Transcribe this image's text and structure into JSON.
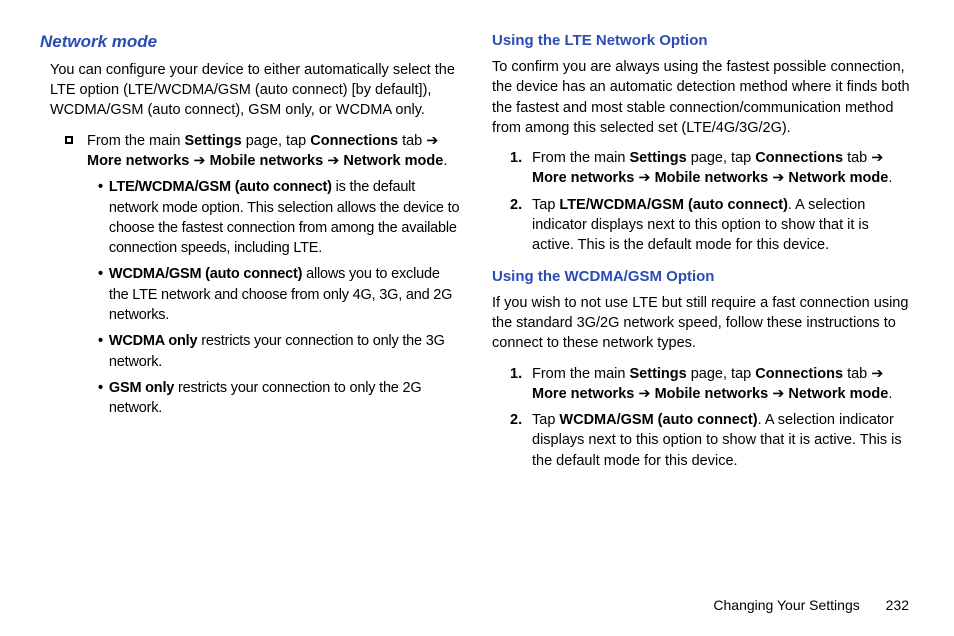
{
  "col1": {
    "heading": "Network mode",
    "intro": "You can configure your device to either automatically select the LTE option (LTE/WCDMA/GSM (auto connect) [by default]), WCDMA/GSM (auto connect), GSM only, or WCDMA only.",
    "main_step": {
      "t1": "From the main ",
      "b1": "Settings",
      "t2": " page, tap ",
      "b2": "Connections",
      "t3": " tab ",
      "arr1": "➔",
      "t4": " ",
      "b3": "More networks",
      "t5": " ",
      "arr2": "➔",
      "t6": " ",
      "b4": "Mobile networks",
      "t7": " ",
      "arr3": "➔",
      "t8": " ",
      "b5": "Network mode",
      "t9": "."
    },
    "opt1": {
      "b": "LTE/WCDMA/GSM (auto connect)",
      "t": " is the default network mode option. This selection allows the device to choose the fastest connection from among the available connection speeds, including LTE."
    },
    "opt2": {
      "b": "WCDMA/GSM (auto connect)",
      "t": " allows you to exclude the LTE network and choose from only 4G, 3G, and 2G networks."
    },
    "opt3": {
      "b": "WCDMA only",
      "t": " restricts your connection to only the 3G network."
    },
    "opt4": {
      "b": "GSM only",
      "t": " restricts your connection to only the 2G network."
    }
  },
  "col2": {
    "h1": "Using the LTE Network Option",
    "p1": "To confirm you are always using the fastest possible connection, the device has an automatic detection method where it finds both the fastest and most stable connection/communication method from among this selected set (LTE/4G/3G/2G).",
    "lte_step1": {
      "num": "1.",
      "t1": "From the main ",
      "b1": "Settings",
      "t2": " page, tap ",
      "b2": "Connections",
      "t3": " tab ",
      "arr1": "➔",
      "t4": " ",
      "b3": "More networks",
      "t5": " ",
      "arr2": "➔",
      "t6": " ",
      "b4": "Mobile networks",
      "t7": " ",
      "arr3": "➔",
      "t8": " ",
      "b5": "Network mode",
      "t9": "."
    },
    "lte_step2": {
      "num": "2.",
      "t1": "Tap ",
      "b1": "LTE/WCDMA/GSM (auto connect)",
      "t2": ". A selection indicator displays next to this option to show that it is active. This is the default mode for this device."
    },
    "h2": "Using the WCDMA/GSM Option",
    "p2": "If you wish to not use LTE but still require a fast connection using the standard 3G/2G network speed, follow these instructions to connect to these network types.",
    "w_step1": {
      "num": "1.",
      "t1": "From the main ",
      "b1": "Settings",
      "t2": " page, tap ",
      "b2": "Connections",
      "t3": " tab ",
      "arr1": "➔",
      "t4": " ",
      "b3": "More networks",
      "t5": " ",
      "arr2": "➔",
      "t6": " ",
      "b4": "Mobile networks",
      "t7": " ",
      "arr3": "➔",
      "t8": " ",
      "b5": "Network mode",
      "t9": "."
    },
    "w_step2": {
      "num": "2.",
      "t1": "Tap ",
      "b1": "WCDMA/GSM (auto connect)",
      "t2": ". A selection indicator displays next to this option to show that it is active. This is the default mode for this device."
    }
  },
  "footer": {
    "title": "Changing Your Settings",
    "page": "232"
  }
}
